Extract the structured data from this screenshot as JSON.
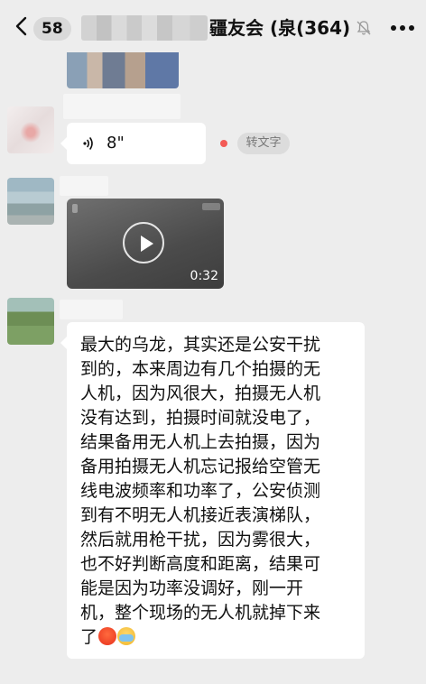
{
  "header": {
    "unread_count": "58",
    "title": "疆友会 (泉",
    "member_count": "(364)",
    "icons": {
      "back": "chevron-left-icon",
      "mute": "bell-mute-icon",
      "more": "more-dots-icon"
    }
  },
  "messages": {
    "voice": {
      "duration": "8\"",
      "to_text_label": "转文字"
    },
    "video": {
      "duration": "0:32"
    },
    "text": {
      "lines": [
        "最大的乌龙，其实还是公安干扰",
        "到的，本来周边有几个拍摄的无",
        "人机，因为风很大，拍摄无人机",
        "没有达到，拍摄时间就没电了，",
        "结果备用无人机上去拍摄，因为",
        "备用拍摄无人机忘记报给空管无",
        "线电波频率和功率了，公安侦测",
        "到有不明无人机接近表演梯队，",
        "然后就用枪干扰，因为雾很大，",
        "也不好判断高度和距离，结果可",
        "能是因为功率没调好，刚一开",
        "机，整个现场的无人机就掉下来",
        "了"
      ],
      "emojis": [
        "angry-face-icon",
        "crying-face-icon"
      ]
    }
  },
  "colors": {
    "background": "#ededed",
    "bubble": "#ffffff",
    "unread_dot": "#f35a55"
  }
}
